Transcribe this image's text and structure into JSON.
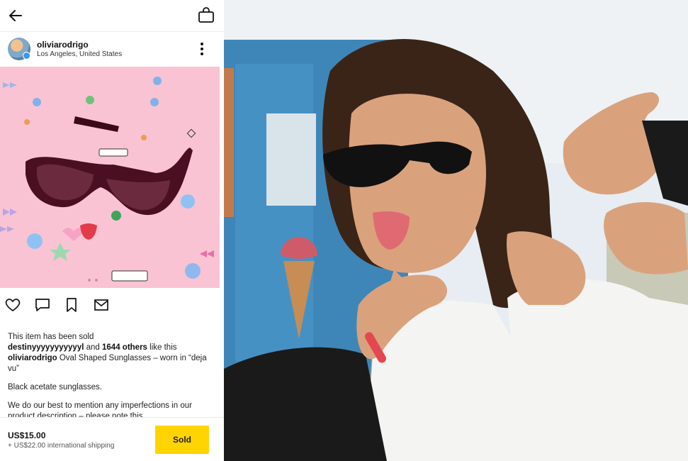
{
  "header": {
    "back_icon": "arrow-left-icon",
    "bag_icon": "shopping-bag-icon"
  },
  "seller": {
    "username": "oliviarodrigo",
    "location": "Los Angeles, United States",
    "avatar_icon": "avatar",
    "verified_icon": "verified-badge-icon",
    "more_icon": "more-vertical-icon"
  },
  "actions": {
    "like_icon": "heart-icon",
    "comment_icon": "comment-icon",
    "save_icon": "bookmark-icon",
    "message_icon": "envelope-icon"
  },
  "listing": {
    "sold_notice": "This item has been sold",
    "liked_by_user": "destinyyyyyyyyyyyl",
    "liked_and": "and",
    "liked_count": "1644 others",
    "liked_suffix": "like this",
    "title": "Oval Shaped Sunglasses – worn in “deja vu”",
    "description_1": "Black acetate sunglasses.",
    "description_2": "We do our best to mention any imperfections in our product description – please note this"
  },
  "purchase": {
    "price": "US$15.00",
    "shipping": "+ US$22.00 international shipping",
    "button_label": "Sold"
  },
  "colors": {
    "accent_yellow": "#ffd400",
    "photo_pink": "#f9c3d3",
    "verified_blue": "#3897f0"
  }
}
